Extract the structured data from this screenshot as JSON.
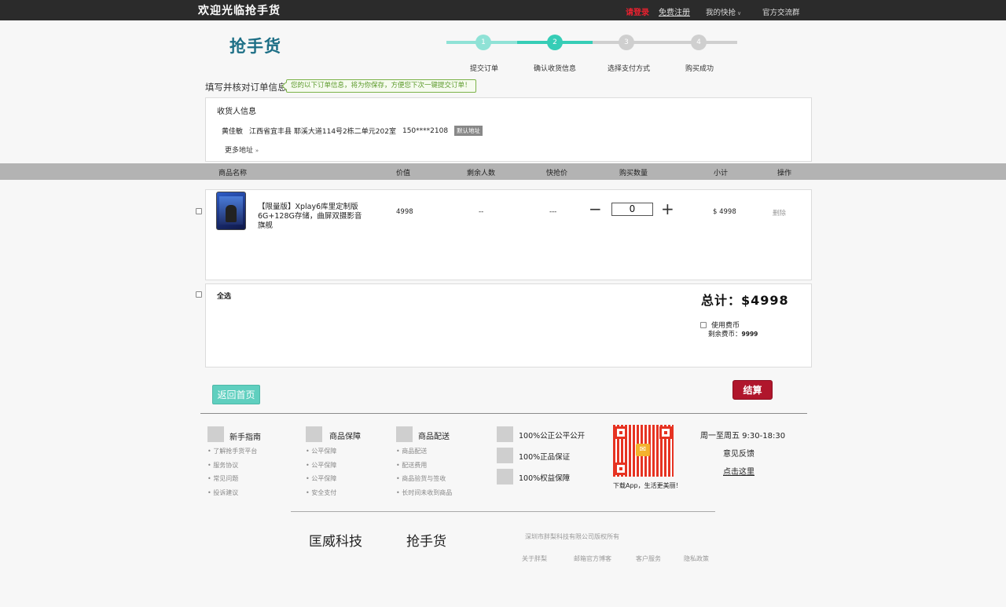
{
  "topbar": {
    "welcome": "欢迎光临抢手货",
    "login": "请登录",
    "register": "免费注册",
    "my_qiang": "我的快抢",
    "group": "官方交流群"
  },
  "brand": "抢手货",
  "steps": [
    {
      "num": "1",
      "label": "提交订单"
    },
    {
      "num": "2",
      "label": "确认收货信息"
    },
    {
      "num": "3",
      "label": "选择支付方式"
    },
    {
      "num": "4",
      "label": "购买成功"
    }
  ],
  "form": {
    "title": "填写并核对订单信息",
    "tip": "您的以下订单信息，将为你保存，方便您下次一键提交订单！"
  },
  "receiver": {
    "title": "收货人信息",
    "name": "黄佳敏",
    "address": "江西省宜丰县 耶溪大道114号2栋二单元202室",
    "phone": "150****2108",
    "default_badge": "默认地址",
    "more": "更多地址"
  },
  "table": {
    "headers": [
      "商品名称",
      "价值",
      "剩余人数",
      "快抢价",
      "购买数量",
      "小计",
      "操作"
    ],
    "row": {
      "name": "【限量版】Xplay6库里定制版6G+128G存储，曲屏双摄影音旗舰",
      "value": "4998",
      "remaining": "--",
      "flash_price": "---",
      "qty": "0",
      "subtotal": "$ 4998",
      "action": "删除"
    }
  },
  "summary": {
    "select_all": "全选",
    "total": "总计：$4998",
    "use_coin": "使用费币",
    "remain_label": "剩余费币：",
    "remain_value": "9999"
  },
  "buttons": {
    "back": "返回首页",
    "pay": "结算"
  },
  "footer": {
    "cols": [
      {
        "title": "新手指南",
        "items": [
          "• 了解抢手货平台",
          "• 服务协议",
          "• 常见问题",
          "• 投诉建议"
        ]
      },
      {
        "title": "商品保障",
        "items": [
          "• 公平保障",
          "• 公平保障",
          "• 公平保障",
          "• 安全支付"
        ]
      },
      {
        "title": "商品配送",
        "items": [
          "• 商品配送",
          "• 配送费用",
          "• 商品验货与签收",
          "• 长时间未收到商品"
        ]
      }
    ],
    "guarantees": [
      "100%公正公平公开",
      "100%正品保证",
      "100%权益保障"
    ],
    "qr_caption": "下载App，生活更美丽！",
    "service_hours": "周一至周五 9:30-18:30",
    "feedback": "意见反馈",
    "click_here": "点击这里",
    "company1": "匡威科技",
    "company2": "抢手货",
    "copyright": "深圳市胖梨科技有限公司版权所有",
    "links": [
      "关于胖梨",
      "邮箱官方博客",
      "客户服务",
      "隐私政策"
    ]
  },
  "colors": {
    "teal": "#5fd3c3",
    "brand_blue": "#1d6f86",
    "pay_red": "#b0162c",
    "login_red": "#e8212f"
  }
}
